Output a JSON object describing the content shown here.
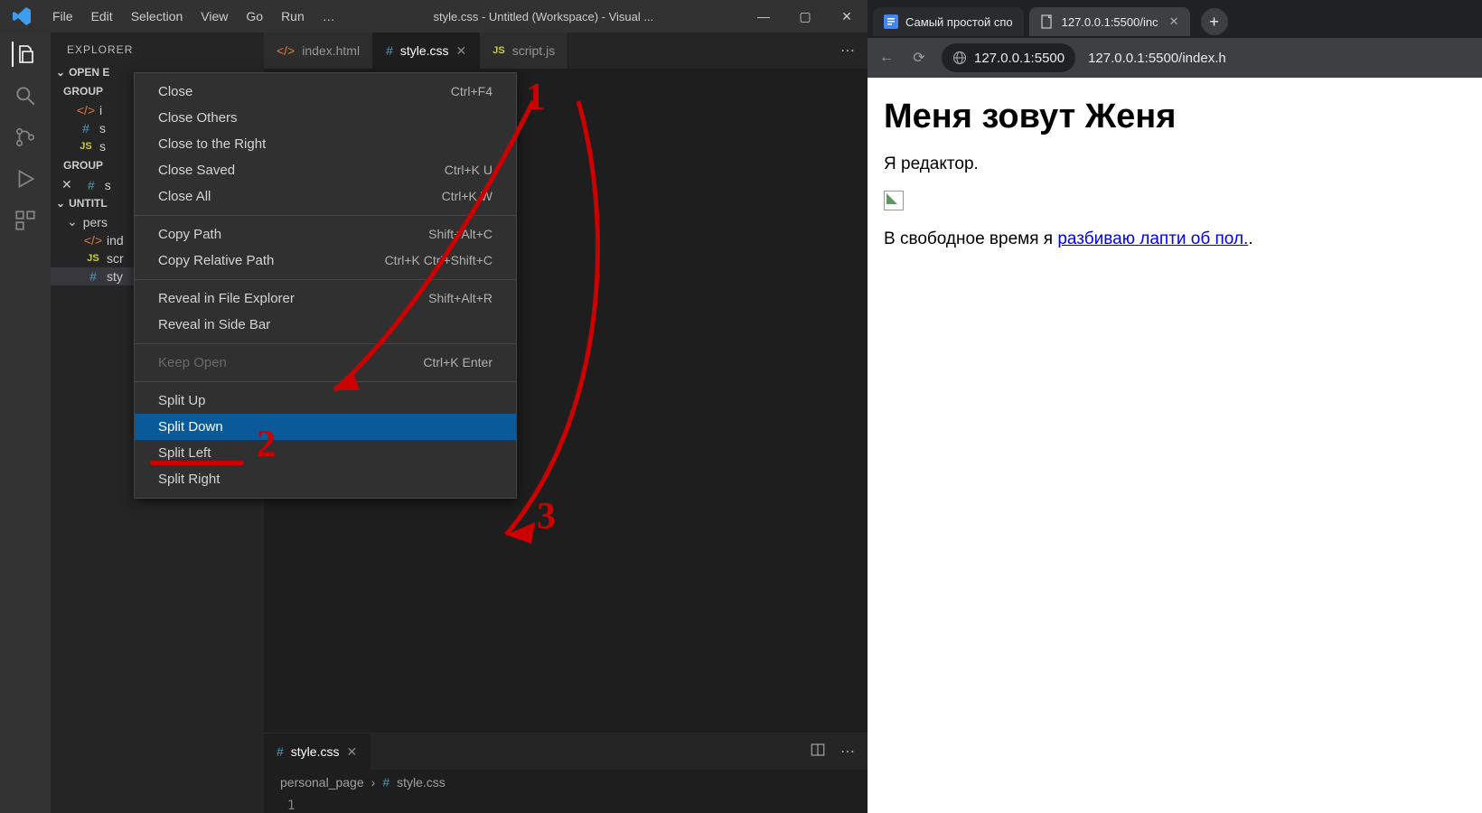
{
  "titlebar": {
    "menu": [
      "File",
      "Edit",
      "Selection",
      "View",
      "Go",
      "Run",
      "…"
    ],
    "title": "style.css - Untitled (Workspace) - Visual ..."
  },
  "sidebar": {
    "header": "EXPLORER",
    "open_editors": "OPEN E",
    "group1": "GROUP",
    "group2": "GROUP",
    "workspace": "UNTITL",
    "folder": "pers",
    "files_g1": [
      {
        "icon": "html",
        "label": "i"
      },
      {
        "icon": "css",
        "label": "s"
      },
      {
        "icon": "js",
        "label": "s"
      }
    ],
    "files_g2": [
      {
        "icon": "css",
        "label": "s",
        "close": true
      }
    ],
    "files_ws": [
      {
        "icon": "html",
        "label": "ind"
      },
      {
        "icon": "js",
        "label": "scr"
      },
      {
        "icon": "css",
        "label": "sty"
      }
    ]
  },
  "tabs": {
    "top": [
      {
        "icon": "html",
        "label": "index.html",
        "active": false
      },
      {
        "icon": "css",
        "label": "style.css",
        "active": true
      },
      {
        "icon": "js",
        "label": "script.js",
        "active": false
      }
    ],
    "bottom": {
      "icon": "css",
      "label": "style.css"
    }
  },
  "breadcrumbs": {
    "folder": "personal_page",
    "file": "style.css"
  },
  "gutter_line": "1",
  "context_menu": [
    {
      "label": "Close",
      "shortcut": "Ctrl+F4"
    },
    {
      "label": "Close Others",
      "shortcut": ""
    },
    {
      "label": "Close to the Right",
      "shortcut": ""
    },
    {
      "label": "Close Saved",
      "shortcut": "Ctrl+K U"
    },
    {
      "label": "Close All",
      "shortcut": "Ctrl+K W"
    },
    {
      "sep": true
    },
    {
      "label": "Copy Path",
      "shortcut": "Shift+Alt+C"
    },
    {
      "label": "Copy Relative Path",
      "shortcut": "Ctrl+K Ctrl+Shift+C"
    },
    {
      "sep": true
    },
    {
      "label": "Reveal in File Explorer",
      "shortcut": "Shift+Alt+R"
    },
    {
      "label": "Reveal in Side Bar",
      "shortcut": ""
    },
    {
      "sep": true
    },
    {
      "label": "Keep Open",
      "shortcut": "Ctrl+K Enter",
      "disabled": true
    },
    {
      "sep": true
    },
    {
      "label": "Split Up",
      "shortcut": ""
    },
    {
      "label": "Split Down",
      "shortcut": "",
      "highlight": true
    },
    {
      "label": "Split Left",
      "shortcut": ""
    },
    {
      "label": "Split Right",
      "shortcut": ""
    }
  ],
  "annotations": {
    "n1": "1",
    "n2": "2",
    "n3": "3"
  },
  "browser": {
    "tabs": [
      {
        "label": "Самый простой спо",
        "active": false,
        "icon": "docs"
      },
      {
        "label": "127.0.0.1:5500/inc",
        "active": true,
        "icon": "page"
      }
    ],
    "address_short": "127.0.0.1:5500",
    "address_rest": "127.0.0.1:5500/index.h",
    "page": {
      "h1": "Меня зовут Женя",
      "p1": "Я редактор.",
      "p2_prefix": "В свободное время я ",
      "p2_link": "разбиваю лапти об пол.",
      "p2_suffix": "."
    }
  }
}
